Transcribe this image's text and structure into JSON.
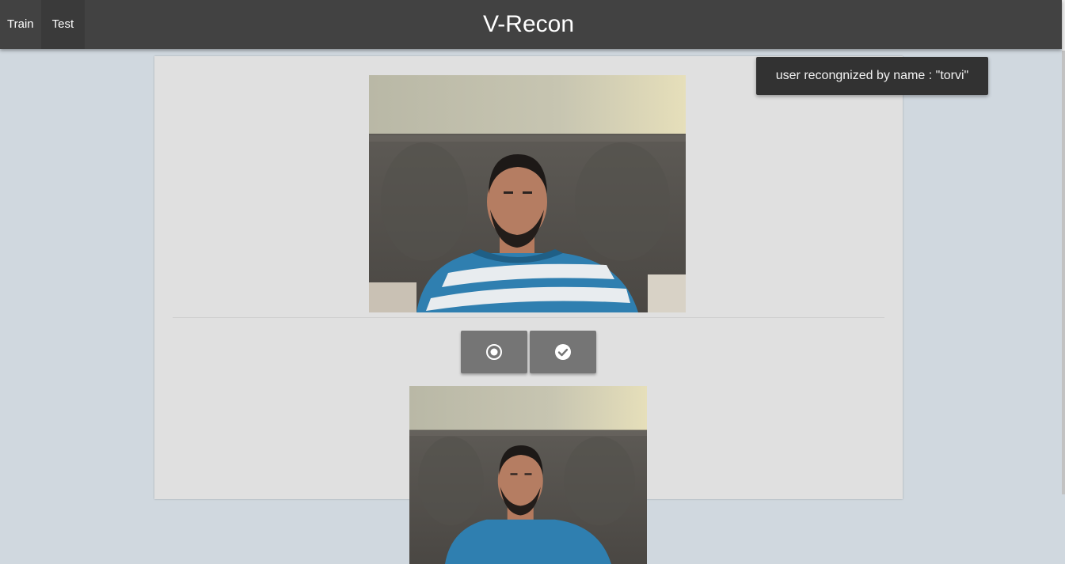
{
  "nav": {
    "items": [
      {
        "label": "Train"
      },
      {
        "label": "Test"
      }
    ],
    "active": "Test"
  },
  "app": {
    "title": "V-Recon"
  },
  "toast": {
    "message": "user recongnized by name : \"torvi\""
  },
  "controls": {
    "capture_icon": "radio-target-icon",
    "confirm_icon": "check-circle-icon"
  },
  "media": {
    "live": "webcam-feed",
    "snapshot": "captured-frame"
  },
  "colors": {
    "appbar": "#424242",
    "background": "#d0d8df",
    "card": "#e0e0e0",
    "button": "#757575",
    "toast": "#323232",
    "shirt_blue": "#2f7fb0"
  }
}
